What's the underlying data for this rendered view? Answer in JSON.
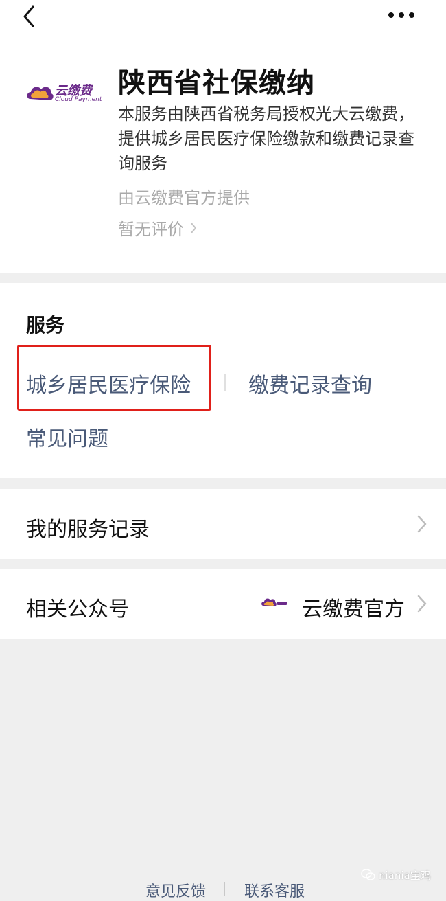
{
  "nav": {
    "back_icon": "chevron-left-icon",
    "more_icon": "more-dots-icon"
  },
  "header": {
    "logo_text_cn": "云缴费",
    "logo_text_en": "Cloud Payment",
    "title": "陕西省社保缴纳",
    "description": "本服务由陕西省税务局授权光大云缴费，提供城乡居民医疗保险缴款和缴费记录查询服务",
    "provider": "由云缴费官方提供",
    "rating": "暂无评价"
  },
  "services": {
    "title": "服务",
    "items": [
      {
        "label": "城乡居民医疗保险"
      },
      {
        "label": "缴费记录查询"
      },
      {
        "label": "常见问题"
      }
    ],
    "highlight_color": "#e0201a"
  },
  "records": {
    "label": "我的服务记录"
  },
  "official": {
    "label": "相关公众号",
    "value": "云缴费官方"
  },
  "footer": {
    "feedback": "意见反馈",
    "customer_service": "联系客服"
  },
  "watermark": {
    "text": "niania宝鸡"
  },
  "colors": {
    "link": "#4a5a78",
    "brand_purple": "#6b2a8a",
    "brand_orange": "#f2a33a",
    "background": "#efefef"
  }
}
